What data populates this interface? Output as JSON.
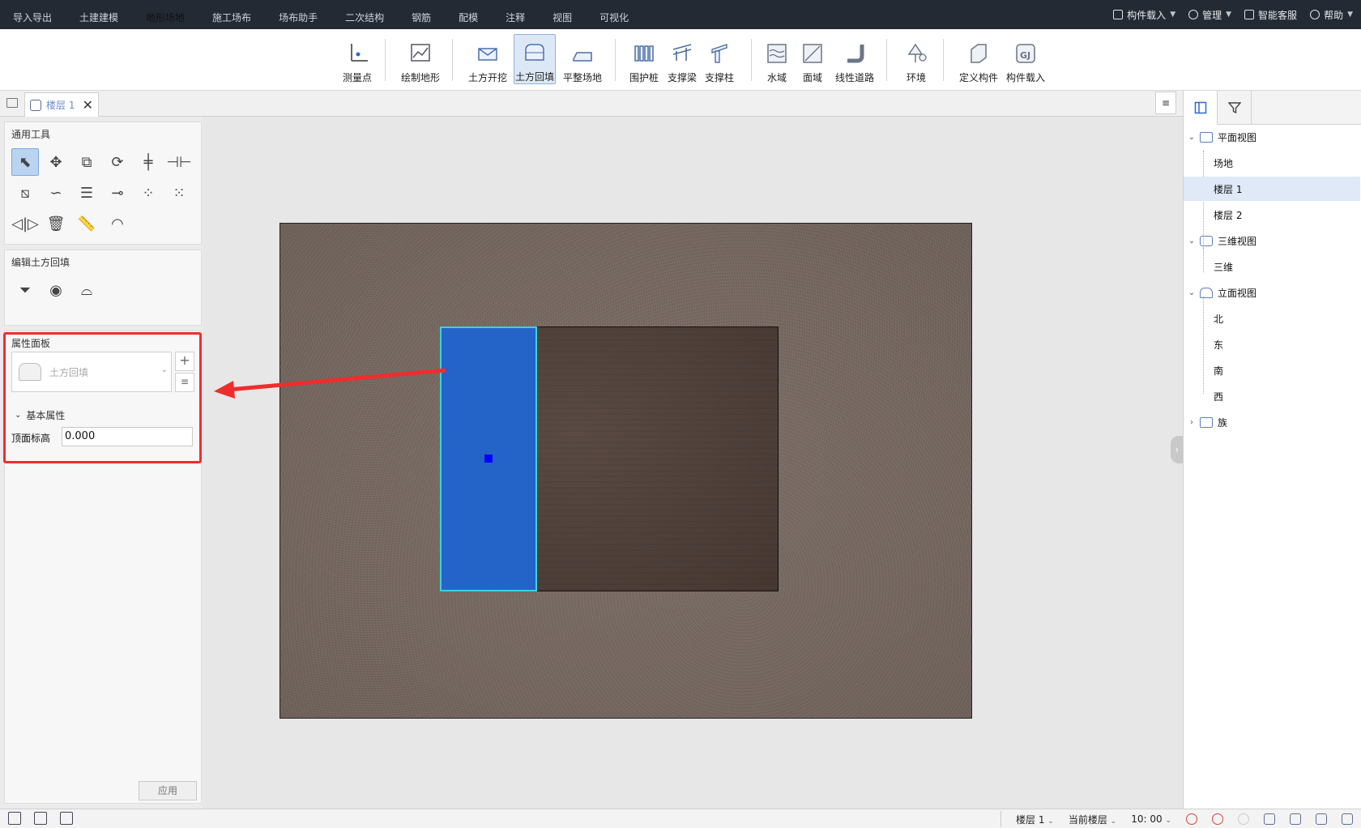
{
  "menubar": {
    "tabs": [
      "导入导出",
      "土建建模",
      "地形场地",
      "施工场布",
      "场布助手",
      "二次结构",
      "钢筋",
      "配模",
      "注释",
      "视图",
      "可视化"
    ],
    "active_tab": "地形场地",
    "right": {
      "component_load": "构件载入",
      "manage": "管理",
      "service": "智能客服",
      "help": "帮助"
    }
  },
  "ribbon": {
    "buttons": {
      "measure_point": "测量点",
      "draw_terrain": "绘制地形",
      "earth_excavation": "土方开挖",
      "earth_backfill": "土方回填",
      "level_site": "平整场地",
      "retaining_pile": "围护桩",
      "support_beam": "支撑梁",
      "support_column": "支撑柱",
      "water_area": "水域",
      "surface_area": "面域",
      "linear_road": "线性道路",
      "environment": "环境",
      "define_component": "定义构件",
      "component_load": "构件载入"
    },
    "active": "土方回填"
  },
  "docbar": {
    "tab_label": "楼层 1",
    "close": "✕",
    "menu": "≡"
  },
  "left": {
    "general_tools_title": "通用工具",
    "edit_title": "编辑土方回填",
    "property_title": "属性面板",
    "type_selector_value": "土方回填",
    "group_basic": "基本属性",
    "field_top_elevation_label": "顶面标高",
    "field_top_elevation_value": "0.000",
    "apply": "应用"
  },
  "right": {
    "tree": {
      "plan_view": "平面视图",
      "site": "场地",
      "floor1": "楼层 1",
      "floor2": "楼层 2",
      "view3d": "三维视图",
      "threed": "三维",
      "elevation": "立面视图",
      "north": "北",
      "east": "东",
      "south": "南",
      "west": "西",
      "family": "族"
    },
    "selected": "楼层 1"
  },
  "statusbar": {
    "floor": "楼层 1",
    "current_floor": "当前楼层",
    "time": "10: 00"
  },
  "colors": {
    "accent_blue": "#2464c9",
    "highlight_red": "#ef2d2d",
    "selection_cyan": "#39d3e0"
  }
}
